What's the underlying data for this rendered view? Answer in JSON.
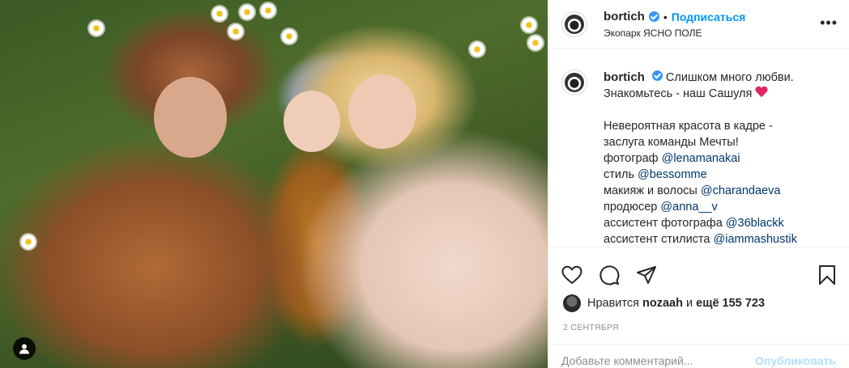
{
  "post": {
    "username": "bortich",
    "follow_label": "Подписаться",
    "separator": "•",
    "location": "Экопарк ЯСНО ПОЛЕ",
    "more_label": "•••",
    "caption": {
      "line1": "Слишком много любви.",
      "line2": "Знакомьтесь - наш Сашуля",
      "line3": "Невероятная красота в кадре -",
      "line4": "заслуга команды Мечты!",
      "credits": [
        {
          "role": "фотограф",
          "mention": "@lenamanakai"
        },
        {
          "role": "стиль",
          "mention": "@bessomme"
        },
        {
          "role": "макияж и волосы",
          "mention": "@charandaeva"
        },
        {
          "role": "продюсер",
          "mention": "@anna__v"
        },
        {
          "role": "ассистент фотографа",
          "mention": "@36blackk"
        },
        {
          "role": "ассистент стилиста",
          "mention": "@iammashustik"
        }
      ]
    },
    "likes": {
      "prefix": "Нравится",
      "user": "nozaah",
      "middle": "и",
      "rest": "ещё 155 723"
    },
    "date": "2 СЕНТЯБРЯ",
    "comment": {
      "placeholder": "Добавьте комментарий...",
      "publish_label": "Опубликовать"
    },
    "icons": {
      "like": "heart-outline-icon",
      "comment": "comment-bubble-icon",
      "share": "paper-plane-icon",
      "save": "bookmark-icon",
      "verified": "verified-badge-icon",
      "user_tag": "user-tag-icon"
    },
    "colors": {
      "link": "#0095f6",
      "mention": "#00376b",
      "verified": "#3897f0",
      "heart": "#e0245e"
    }
  }
}
